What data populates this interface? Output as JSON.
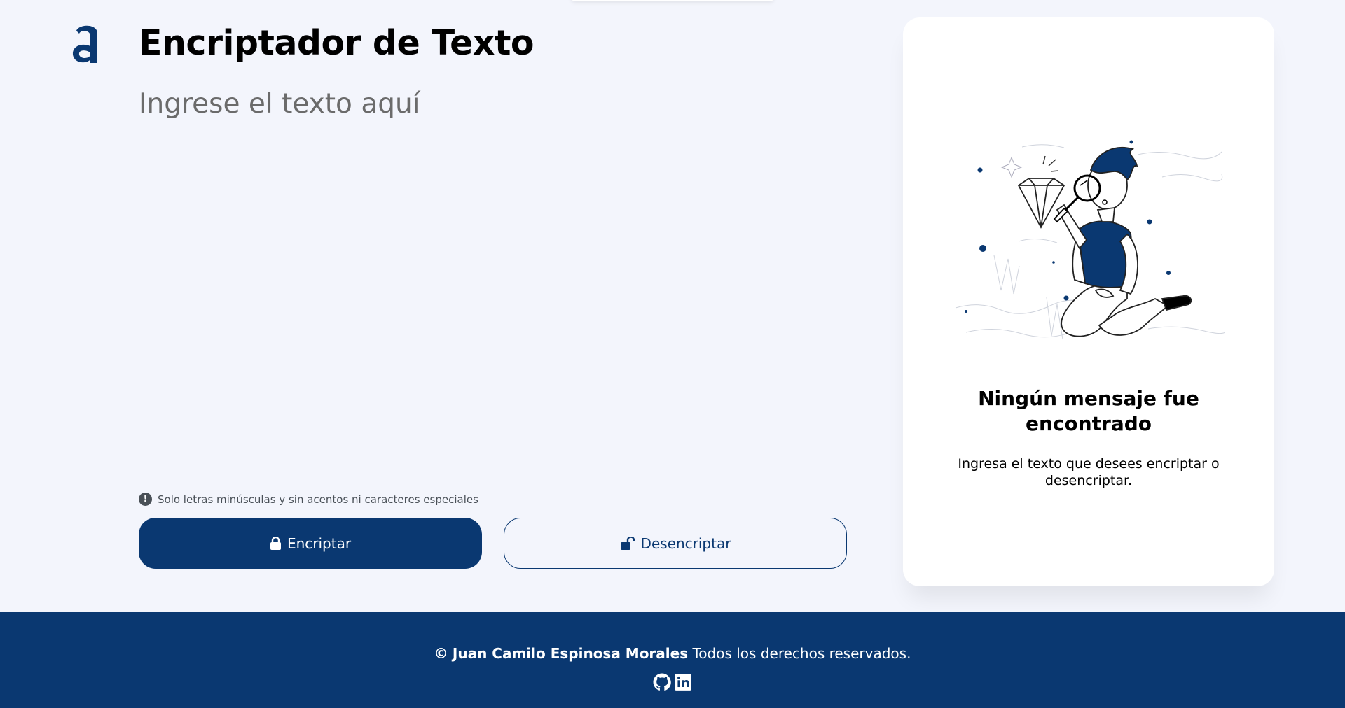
{
  "app": {
    "title": "Encriptador de Texto",
    "brand_color": "#0A3871",
    "logo_icon": "alura-logo-icon"
  },
  "input": {
    "placeholder": "Ingrese el texto aquí",
    "value": ""
  },
  "hint": {
    "icon": "exclamation-circle-icon",
    "text": "Solo letras minúsculas y sin acentos ni caracteres especiales"
  },
  "buttons": {
    "encrypt_label": "Encriptar",
    "encrypt_icon": "lock-icon",
    "decrypt_label": "Desencriptar",
    "decrypt_icon": "unlock-icon"
  },
  "output": {
    "illustration": "boy-with-magnifying-glass-illustration",
    "empty_title": "Ningún mensaje fue encontrado",
    "empty_description": "Ingresa el texto que desees encriptar o desencriptar."
  },
  "footer": {
    "copyright_symbol": "©",
    "author": "Juan Camilo Espinosa Morales",
    "rights": "Todos los derechos reservados.",
    "social_icons": [
      "github-icon",
      "linkedin-icon"
    ]
  }
}
